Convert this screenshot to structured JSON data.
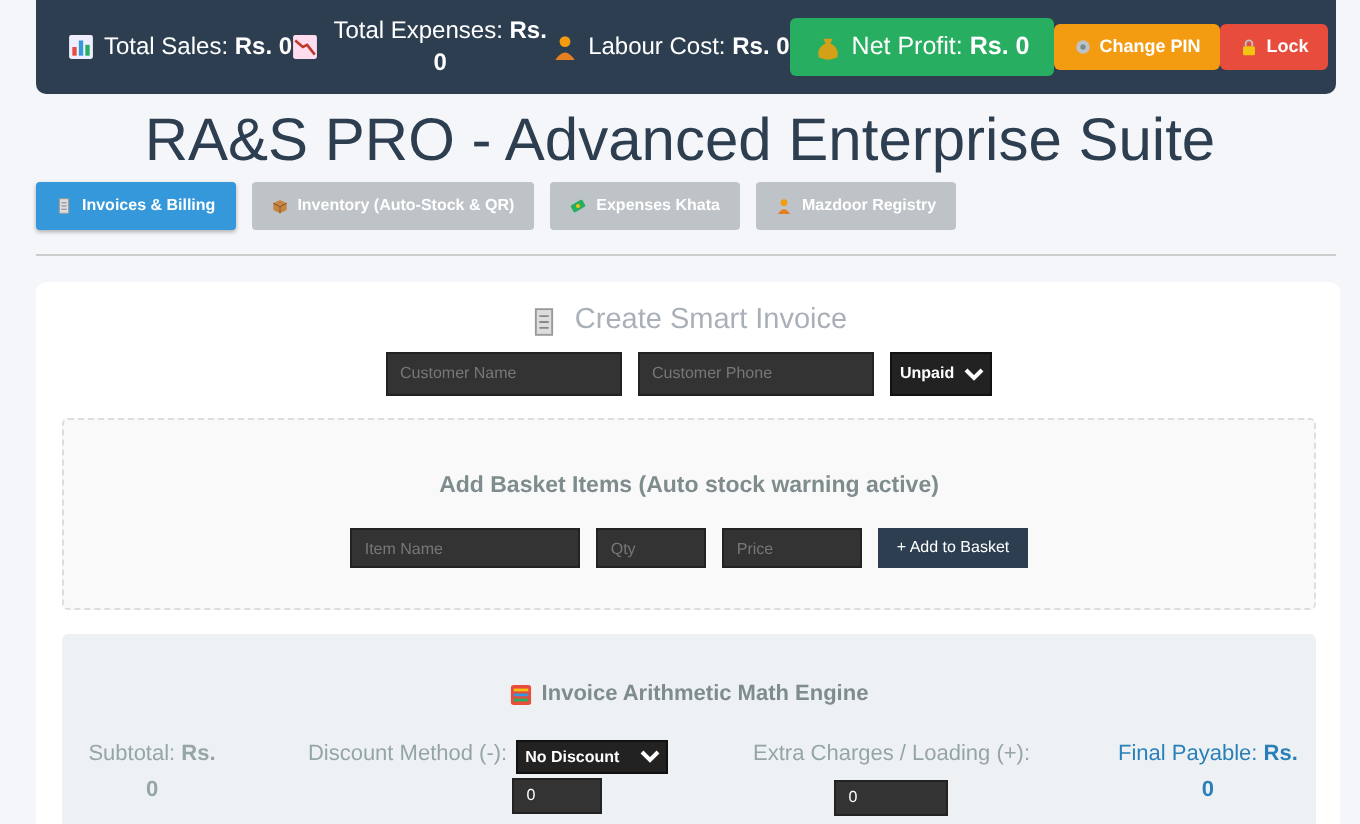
{
  "header": {
    "stats": [
      {
        "kind": "sales",
        "text": "Total Sales: **Rs. 0**"
      },
      {
        "kind": "expenses",
        "text": "Total Expenses: **Rs. 0**"
      },
      {
        "kind": "labour",
        "text": "Labour Cost: **Rs. 0**"
      }
    ],
    "net_profit": "Net Profit: **Rs. 0**",
    "buttons": [
      {
        "label": "Change PIN",
        "kind": "pin"
      },
      {
        "label": "Lock",
        "kind": "lock"
      }
    ]
  },
  "title": "RA&S PRO - Advanced Enterprise Suite",
  "tabs": [
    {
      "label": "Invoices & Billing",
      "kind": "invoice",
      "selected": true
    },
    {
      "label": "Inventory (Auto-Stock & QR)",
      "kind": "box",
      "selected": false
    },
    {
      "label": "Expenses Khata",
      "kind": "money",
      "selected": false
    },
    {
      "label": "Mazdoor Registry",
      "kind": "worker",
      "selected": false
    }
  ],
  "invoice": {
    "heading": "Create Smart Invoice",
    "customer_name": {
      "placeholder": "Customer Name"
    },
    "customer_phone": {
      "placeholder": "Customer Phone"
    },
    "status": "Unpaid"
  },
  "basket": {
    "heading": "Add Basket Items (Auto stock warning active)",
    "fields": [
      {
        "placeholder": "Item Name"
      },
      {
        "placeholder": "Qty"
      },
      {
        "placeholder": "Price"
      }
    ],
    "button": "+ Add to Basket"
  },
  "math": {
    "heading": "Invoice Arithmetic Math Engine",
    "subtotal": "Subtotal: **Rs. 0**",
    "discount_label": "Discount Method (-):",
    "discount_method": "No Discount",
    "discount_value": "0",
    "extra_label": "Extra Charges / Loading (+):",
    "extra_value": "0",
    "final": "Final Payable: **Rs. 0**"
  }
}
